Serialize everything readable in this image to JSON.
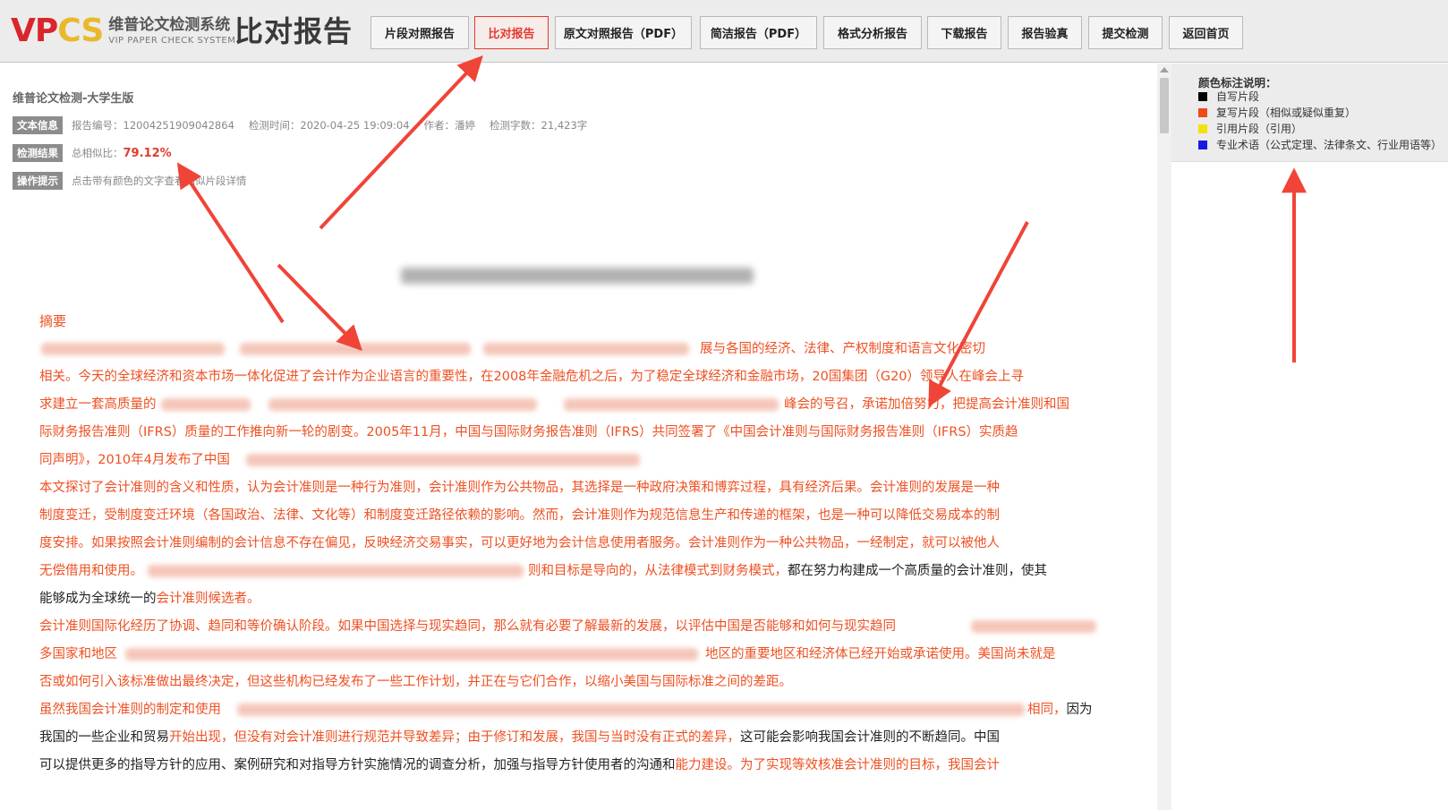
{
  "header": {
    "logo_mark_a": "VP",
    "logo_mark_b": "CS",
    "logo_cn": "维普论文检测系统",
    "logo_en": "VIP PAPER CHECK SYSTEM",
    "page_heading": "比对报告",
    "nav": [
      {
        "label": "片段对照报告",
        "active": false
      },
      {
        "label": "比对报告",
        "active": true
      },
      {
        "label": "原文对照报告（PDF）",
        "active": false
      },
      {
        "label": "简洁报告（PDF）",
        "active": false
      },
      {
        "label": "格式分析报告",
        "active": false
      },
      {
        "label": "下载报告",
        "active": false
      },
      {
        "label": "报告验真",
        "active": false
      },
      {
        "label": "提交检测",
        "active": false
      },
      {
        "label": "返回首页",
        "active": false
      }
    ]
  },
  "report": {
    "system_title": "维普论文检测-大学生版",
    "text_info_tag": "文本信息",
    "report_no": "报告编号：12004251909042864",
    "check_time": "检测时间：2020-04-25 19:09:04",
    "author": "作者：潘婷",
    "word_count": "检测字数：21,423字",
    "result_tag": "检测结果",
    "similarity_label": "总相似比：",
    "similarity_value": "79.12%",
    "tip_tag": "操作提示",
    "tip_text": "点击带有颜色的文字查看相似片段详情"
  },
  "document": {
    "abstract_heading": "摘要",
    "lines": [
      {
        "red": "展与各国的经济、法律、产权制度和语言文化密切",
        "black": ""
      },
      {
        "red": "相关。今天的全球经济和资本市场一体化促进了会计作为企业语言的重要性，在2008年金融危机之后，为了稳定全球经济和金融市场，20国集团（G20）领导人在峰会上寻",
        "black": ""
      },
      {
        "red": "求建立一套高质量的",
        "black": ""
      },
      {
        "red": "峰会的号召，承诺加倍努力，把提高会计准则和国",
        "black": ""
      },
      {
        "red": "际财务报告准则（IFRS）质量的工作推向新一轮的剧变。2005年11月，中国与国际财务报告准则（IFRS）共同签署了《中国会计准则与国际财务报告准则（IFRS）实质趋",
        "black": ""
      },
      {
        "red": "同声明》，2010年4月发布了中国",
        "black": ""
      },
      {
        "red": "本文探讨了会计准则的含义和性质，认为会计准则是一种行为准则，会计准则作为公共物品，其选择是一种政府决策和博弈过程，具有经济后果。会计准则的发展是一种",
        "black": ""
      },
      {
        "red": "制度变迁，受制度变迁环境（各国政治、法律、文化等）和制度变迁路径依赖的影响。然而，会计准则作为规范信息生产和传递的框架，也是一种可以降低交易成本的制",
        "black": ""
      },
      {
        "red": "度安排。如果按照会计准则编制的会计信息不存在偏见，反映经济交易事实，可以更好地为会计信息使用者服务。会计准则作为一种公共物品，一经制定，就可以被他人",
        "black": ""
      },
      {
        "red": "无偿借用和使用。",
        "black": ""
      },
      {
        "red": "则和目标是导向的，从法律模式到财务模式，",
        "black": "都在努力构建成一个高质量的会计准则，使其"
      },
      {
        "red": "",
        "black": "能够成为全球统一的"
      },
      {
        "red": "会计准则候选者。",
        "black": ""
      },
      {
        "red": "会计准则国际化经历了协调、趋同和等价确认阶段。如果中国选择与现实趋同，那么就有必要了解最新的发展，以评估中国是否能够和如何与现实趋同",
        "black": ""
      },
      {
        "red": "多国家和地区",
        "black": ""
      },
      {
        "red": "地区的重要地区和经济体已经开始或承诺使用。美国尚未就是",
        "black": ""
      },
      {
        "red": "否或如何引入该标准做出最终决定，但这些机构已经发布了一些工作计划，并正在与它们合作，以缩小美国与国际标准之间的差距。",
        "black": ""
      },
      {
        "red": "虽然我国会计准则的制定和使用",
        "black": ""
      },
      {
        "red": "相同，",
        "black": "因为"
      },
      {
        "red": "",
        "black": "我国的一些企业和贸易"
      },
      {
        "red": "开始出现，但没有对会计准则进行规范并导致差异；由于修订和发展，我国与当时没有正式的差异，",
        "black": "这可能会影响我国会计准则的不断趋同。中国"
      },
      {
        "red": "",
        "black": "可以提供更多的指导方针的应用、案例研究和对指导方针实施情况的调查分析，加强与指导方针使用者的沟通和"
      },
      {
        "red": "能力建设。为了实现等效核准会计准则的目标，我国会计",
        "black": ""
      }
    ]
  },
  "legend": {
    "title": "颜色标注说明：",
    "items": [
      {
        "label": "自写片段",
        "color": "#000000"
      },
      {
        "label": "复写片段（相似或疑似重复）",
        "color": "#ee4b16"
      },
      {
        "label": "引用片段（引用）",
        "color": "#f2e10c"
      },
      {
        "label": "专业术语（公式定理、法律条文、行业用语等）",
        "color": "#1a1ae6"
      }
    ]
  },
  "colors": {
    "accent": "#e23a2e",
    "copied_text": "#ee5022",
    "arrow": "#f04438"
  }
}
